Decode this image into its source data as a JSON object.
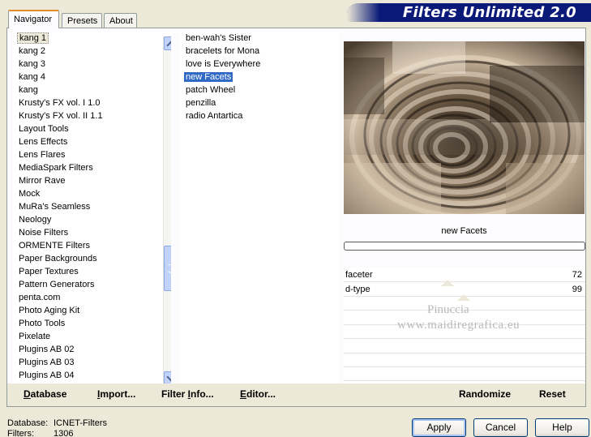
{
  "tabs": [
    {
      "label": "Navigator",
      "active": true
    },
    {
      "label": "Presets",
      "active": false
    },
    {
      "label": "About",
      "active": false
    }
  ],
  "banner": {
    "title": "Filters Unlimited 2.0"
  },
  "categories": {
    "selected": "kang 1",
    "items": [
      "kang 1",
      "kang 2",
      "kang 3",
      "kang 4",
      "kang",
      "Krusty's FX vol. I 1.0",
      "Krusty's FX vol. II 1.1",
      "Layout Tools",
      "Lens Effects",
      "Lens Flares",
      "MediaSpark Filters",
      "Mirror Rave",
      "Mock",
      "MuRa's Seamless",
      "Neology",
      "Noise Filters",
      "ORMENTE Filters",
      "Paper Backgrounds",
      "Paper Textures",
      "Pattern Generators",
      "penta.com",
      "Photo Aging Kit",
      "Photo Tools",
      "Pixelate",
      "Plugins AB 02",
      "Plugins AB 03",
      "Plugins AB 04"
    ],
    "scroll_position": 0.62
  },
  "filters": {
    "selected": "new Facets",
    "items": [
      "ben-wah's Sister",
      "bracelets for Mona",
      "love is Everywhere",
      "new Facets",
      "patch Wheel",
      "penzilla",
      "radio Antartica"
    ]
  },
  "preview": {
    "filter_name": "new Facets",
    "progress": 0
  },
  "parameters": [
    {
      "label": "faceter",
      "value": "72",
      "fraction": 0.28
    },
    {
      "label": "d-type",
      "value": "99",
      "fraction": 0.39
    }
  ],
  "watermark": {
    "line1": "Pinuccia",
    "line2": "www.maidiregrafica.eu"
  },
  "bottom_bar": {
    "database": "Database",
    "import": "Import...",
    "filter_info": "Filter Info...",
    "editor": "Editor...",
    "randomize": "Randomize",
    "reset": "Reset"
  },
  "status": {
    "database_label": "Database:",
    "database_value": "ICNET-Filters",
    "filters_label": "Filters:",
    "filters_value": "1306"
  },
  "buttons": {
    "apply": "Apply",
    "cancel": "Cancel",
    "help": "Help"
  },
  "colors": {
    "banner": "#0b1a78",
    "selection": "#316ac5",
    "tab_accent": "#e68b2c"
  }
}
